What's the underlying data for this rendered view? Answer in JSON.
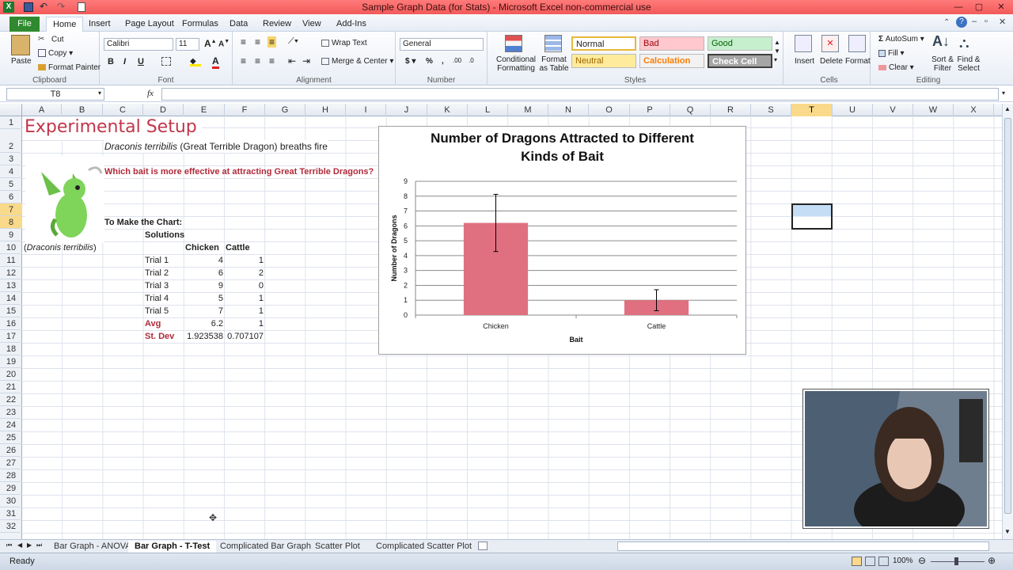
{
  "window": {
    "title": "Sample Graph Data (for Stats)  -  Microsoft Excel non-commercial use",
    "controls": [
      "?",
      "—",
      "▢",
      "✕"
    ]
  },
  "ribbon_tabs": [
    "File",
    "Home",
    "Insert",
    "Page Layout",
    "Formulas",
    "Data",
    "Review",
    "View",
    "Add-Ins"
  ],
  "ribbon": {
    "clipboard": {
      "paste": "Paste",
      "cut": "Cut",
      "copy": "Copy",
      "format_painter": "Format Painter",
      "label": "Clipboard"
    },
    "font": {
      "name": "Calibri",
      "size": "11",
      "bold": "B",
      "italic": "I",
      "underline": "U",
      "label": "Font"
    },
    "alignment": {
      "wrap": "Wrap Text",
      "merge": "Merge & Center",
      "label": "Alignment"
    },
    "number": {
      "format": "General",
      "label": "Number"
    },
    "styles": {
      "conditional": "Conditional Formatting",
      "format_table": "Format as Table",
      "normal": "Normal",
      "bad": "Bad",
      "good": "Good",
      "neutral": "Neutral",
      "calculation": "Calculation",
      "check_cell": "Check Cell",
      "label": "Styles"
    },
    "cells": {
      "insert": "Insert",
      "delete": "Delete",
      "format": "Format",
      "label": "Cells"
    },
    "editing": {
      "autosum": "AutoSum",
      "fill": "Fill",
      "clear": "Clear",
      "sort": "Sort & Filter",
      "find": "Find & Select",
      "label": "Editing"
    }
  },
  "formula_bar": {
    "name_box": "T8",
    "fx": "fx",
    "value": ""
  },
  "columns": [
    "A",
    "B",
    "C",
    "D",
    "E",
    "F",
    "G",
    "H",
    "I",
    "J",
    "K",
    "L",
    "M",
    "N",
    "O",
    "P",
    "Q",
    "R",
    "S",
    "T",
    "U",
    "V",
    "W",
    "X"
  ],
  "selected_column": "T",
  "rows": [
    "1",
    "2",
    "3",
    "4",
    "5",
    "6",
    "7",
    "8",
    "9",
    "10",
    "11",
    "12",
    "13",
    "14",
    "15",
    "16",
    "17",
    "18",
    "19",
    "20",
    "21",
    "22",
    "23",
    "24",
    "25",
    "26",
    "27",
    "28",
    "29",
    "30",
    "31",
    "32"
  ],
  "selected_rows": [
    "7",
    "8"
  ],
  "sheet": {
    "title": "Experimental Setup",
    "subtitle_species": "Draconis terribilis",
    "subtitle_rest": " (Great Terrible Dragon) breaths fire",
    "question": "Which bait is more effective at attracting Great Terrible Dragons?",
    "to_make": "To Make the Chart:",
    "solutions": "Solutions",
    "caption_open": "(",
    "caption_species": "Draconis terribilis",
    "caption_close": ")",
    "headers": [
      "Chicken",
      "Cattle"
    ],
    "trials": [
      {
        "label": "Trial 1",
        "chicken": "4",
        "cattle": "1"
      },
      {
        "label": "Trial 2",
        "chicken": "6",
        "cattle": "2"
      },
      {
        "label": "Trial 3",
        "chicken": "9",
        "cattle": "0"
      },
      {
        "label": "Trial 4",
        "chicken": "5",
        "cattle": "1"
      },
      {
        "label": "Trial 5",
        "chicken": "7",
        "cattle": "1"
      }
    ],
    "avg": {
      "label": "Avg",
      "chicken": "6.2",
      "cattle": "1"
    },
    "stdev": {
      "label": "St. Dev",
      "chicken": "1.923538",
      "cattle": "0.707107"
    }
  },
  "chart_data": {
    "type": "bar",
    "title": "Number of Dragons Attracted to Different Kinds of Bait",
    "title_lines": [
      "Number of Dragons Attracted to Different",
      "Kinds of Bait"
    ],
    "categories": [
      "Chicken",
      "Cattle"
    ],
    "values": [
      6.2,
      1
    ],
    "error": [
      1.923538,
      0.707107
    ],
    "xlabel": "Bait",
    "ylabel": "Number of Dragons",
    "ylim": [
      0,
      9
    ],
    "yticks": [
      "0",
      "1",
      "2",
      "3",
      "4",
      "5",
      "6",
      "7",
      "8",
      "9"
    ],
    "grid": true,
    "color": "#e07080"
  },
  "sheet_tabs": [
    "Bar Graph - ANOVA",
    "Bar Graph - T-Test",
    "Complicated Bar Graph",
    "Scatter Plot",
    "Complicated Scatter Plot"
  ],
  "active_sheet": "Bar Graph - T-Test",
  "status": {
    "ready": "Ready",
    "zoom": "100%"
  }
}
